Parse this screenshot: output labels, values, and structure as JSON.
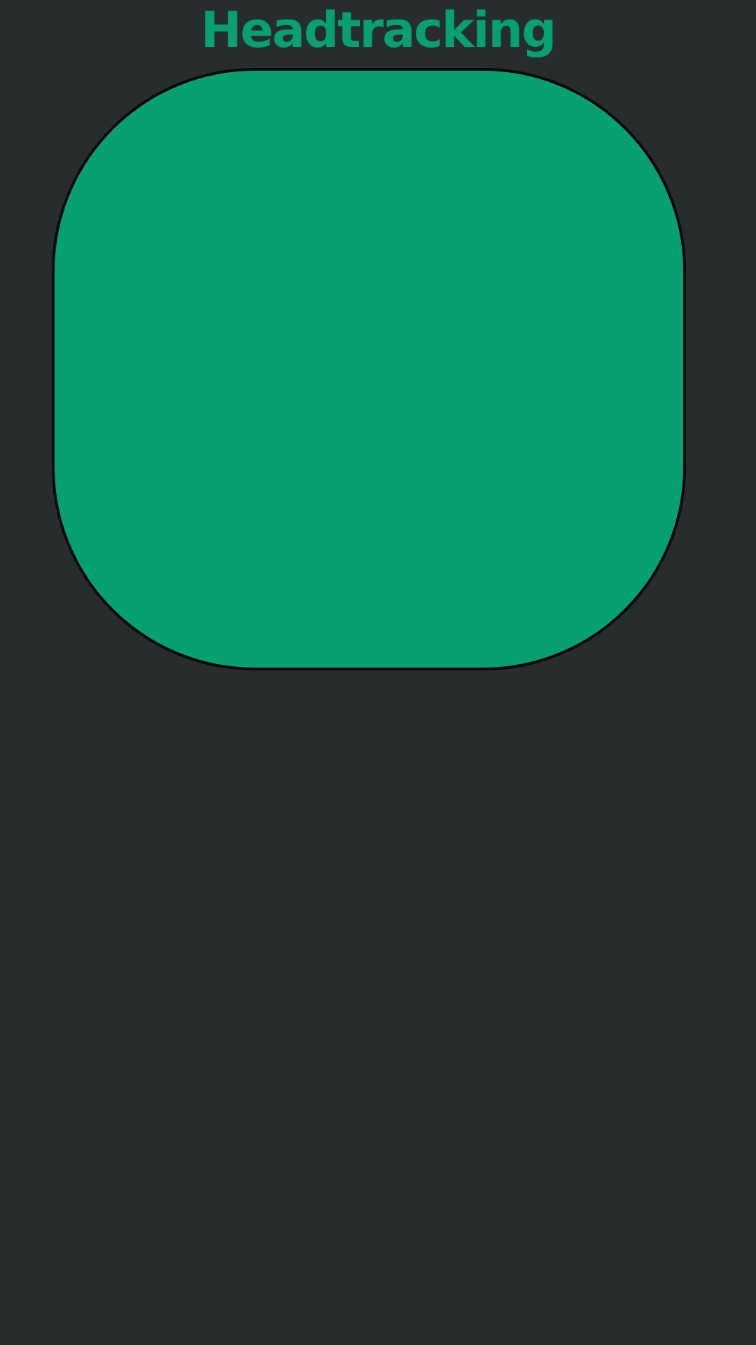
{
  "header": {
    "title": "Headtracking"
  },
  "tracking_area": {
    "label": "",
    "color": "#07a072",
    "border_color": "#050808"
  },
  "theme": {
    "background": "#272c2c",
    "accent": "#07a072"
  }
}
